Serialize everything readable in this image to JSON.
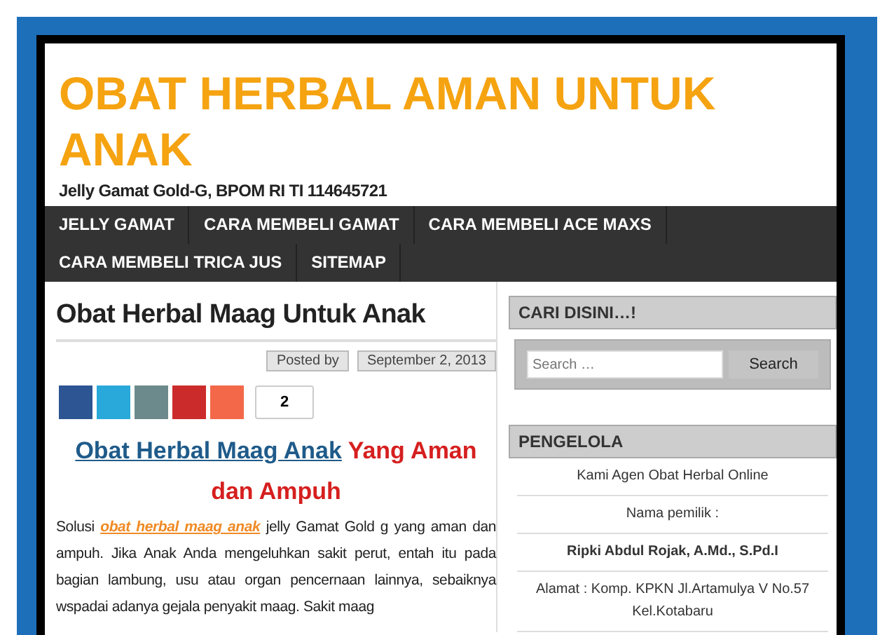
{
  "site": {
    "title": "OBAT HERBAL AMAN UNTUK ANAK",
    "tagline": "Jelly Gamat Gold-G, BPOM RI TI 114645721"
  },
  "nav": [
    {
      "label": "JELLY GAMAT"
    },
    {
      "label": "CARA MEMBELI GAMAT"
    },
    {
      "label": "CARA MEMBELI ACE MAXS"
    },
    {
      "label": "CARA MEMBELI TRICA JUS"
    },
    {
      "label": "SITEMAP"
    }
  ],
  "post": {
    "title": "Obat Herbal Maag Untuk Anak",
    "meta": [
      "Posted by",
      "September 2, 2013"
    ],
    "share": {
      "buttons": [
        {
          "color": "#2d5593"
        },
        {
          "color": "#29a8da"
        },
        {
          "color": "#6c8a8c"
        },
        {
          "color": "#cc2b2b"
        },
        {
          "color": "#f26849"
        }
      ],
      "count": "2"
    },
    "heading": {
      "link": "Obat Herbal Maag Anak",
      "rest": "Yang Aman dan Ampuh"
    },
    "body": {
      "before": "Solusi",
      "link": "obat herbal maag anak",
      "after": "jelly Gamat Gold g yang aman dan ampuh. Jika Anak Anda mengeluhkan sakit perut, entah itu pada bagian lambung, usu atau organ pencernaan lainnya, sebaiknya wspadai adanya gejala penyakit maag. Sakit maag"
    }
  },
  "sidebar": {
    "search_widget": {
      "title": "CARI DISINI…!",
      "placeholder": "Search …",
      "button": "Search"
    },
    "owner_widget": {
      "title": "PENGELOLA",
      "lines": [
        {
          "text": "Kami Agen Obat Herbal Online",
          "bold": false
        },
        {
          "text": "Nama pemilik :",
          "bold": false
        },
        {
          "text": "Ripki Abdul Rojak, A.Md., S.Pd.I",
          "bold": true
        },
        {
          "text": "Alamat : Komp. KPKN Jl.Artamulya V No.57 Kel.Kotabaru",
          "bold": false
        }
      ]
    }
  }
}
